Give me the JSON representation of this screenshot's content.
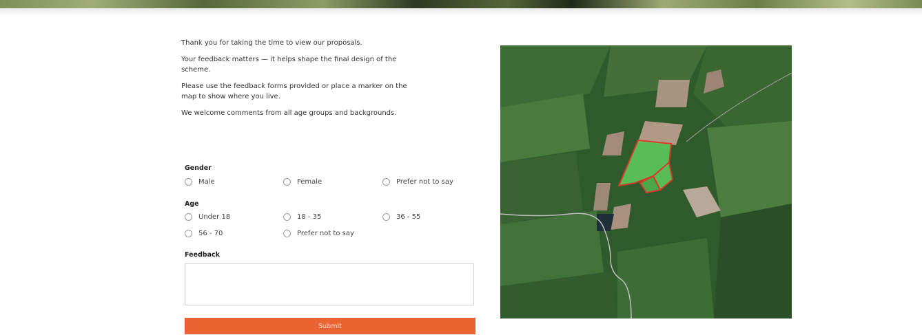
{
  "intro": {
    "line1": "Thank you for taking the time to view our proposals.",
    "line2": "Your feedback matters — it helps shape the final design of the scheme.",
    "line3": "Please use the feedback forms provided or place a marker on the map to show where you live.",
    "line4": "We welcome comments from all age groups and backgrounds."
  },
  "form": {
    "gender_label": "Gender",
    "gender_options": [
      "Male",
      "Female",
      "Prefer not to say"
    ],
    "age_label": "Age",
    "age_options": [
      "Under 18",
      "18 - 35",
      "36 - 55",
      "56 - 70",
      "Prefer not to say"
    ],
    "feedback_label": "Feedback",
    "feedback_value": "",
    "submit_label": "Submit"
  },
  "colors": {
    "accent": "#eb6331",
    "site_boundary": "#d63a2a",
    "site_fill": "#5fcf5f"
  }
}
